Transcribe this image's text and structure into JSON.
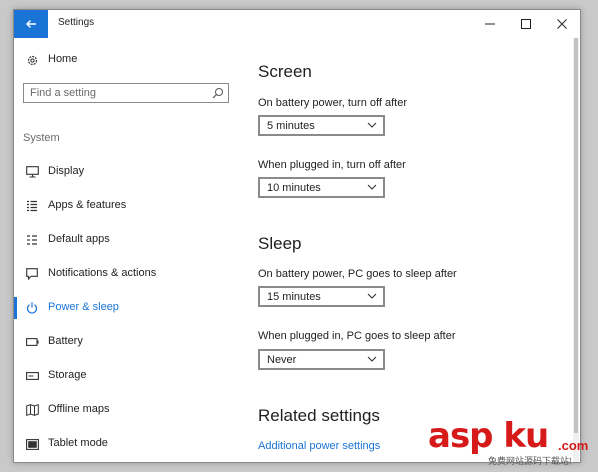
{
  "window": {
    "title": "Settings"
  },
  "sidebar": {
    "home_label": "Home",
    "search_placeholder": "Find a setting",
    "group_header": "System",
    "items": [
      {
        "label": "Display",
        "icon": "monitor-icon"
      },
      {
        "label": "Apps & features",
        "icon": "list-icon"
      },
      {
        "label": "Default apps",
        "icon": "default-apps-icon"
      },
      {
        "label": "Notifications & actions",
        "icon": "notification-icon"
      },
      {
        "label": "Power & sleep",
        "icon": "power-icon",
        "active": true
      },
      {
        "label": "Battery",
        "icon": "battery-icon"
      },
      {
        "label": "Storage",
        "icon": "storage-icon"
      },
      {
        "label": "Offline maps",
        "icon": "map-icon"
      },
      {
        "label": "Tablet mode",
        "icon": "tablet-icon"
      }
    ]
  },
  "main": {
    "screen": {
      "heading": "Screen",
      "battery_label": "On battery power, turn off after",
      "battery_value": "5 minutes",
      "plugged_label": "When plugged in, turn off after",
      "plugged_value": "10 minutes"
    },
    "sleep": {
      "heading": "Sleep",
      "battery_label": "On battery power, PC goes to sleep after",
      "battery_value": "15 minutes",
      "plugged_label": "When plugged in, PC goes to sleep after",
      "plugged_value": "Never"
    },
    "related": {
      "heading": "Related settings",
      "link": "Additional power settings"
    }
  },
  "watermark": {
    "brand": "asp ku",
    "domain": ".com",
    "tagline": "免费网站源码下载站!"
  },
  "colors": {
    "accent": "#1a74d6",
    "watermark": "#d61a1a"
  }
}
